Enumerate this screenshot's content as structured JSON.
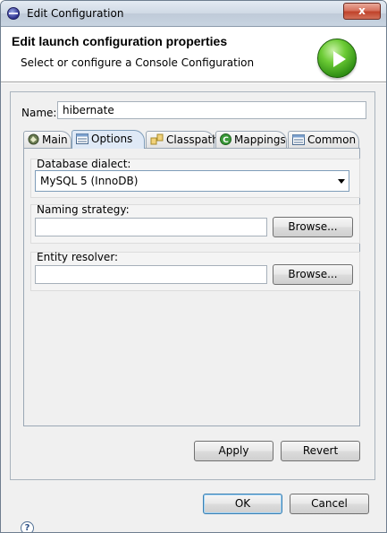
{
  "window": {
    "title": "Edit Configuration",
    "close_label": "x"
  },
  "header": {
    "heading": "Edit launch configuration properties",
    "subtitle": "Select or configure a Console Configuration"
  },
  "form": {
    "name_label": "Name:",
    "name_value": "hibernate"
  },
  "tabs": [
    {
      "label": "Main",
      "icon": "main-tab-icon"
    },
    {
      "label": "Options",
      "icon": "options-tab-icon"
    },
    {
      "label": "Classpath",
      "icon": "classpath-tab-icon"
    },
    {
      "label": "Mappings",
      "icon": "mappings-tab-icon"
    },
    {
      "label": "Common",
      "icon": "common-tab-icon"
    }
  ],
  "active_tab": "Options",
  "options": {
    "dialect_label": "Database dialect:",
    "dialect_value": "MySQL 5 (InnoDB)",
    "naming_label": "Naming strategy:",
    "naming_value": "",
    "naming_browse": "Browse...",
    "entity_label": "Entity resolver:",
    "entity_value": "",
    "entity_browse": "Browse..."
  },
  "actions": {
    "apply": "Apply",
    "revert": "Revert"
  },
  "footer": {
    "ok": "OK",
    "cancel": "Cancel",
    "help_symbol": "?"
  }
}
